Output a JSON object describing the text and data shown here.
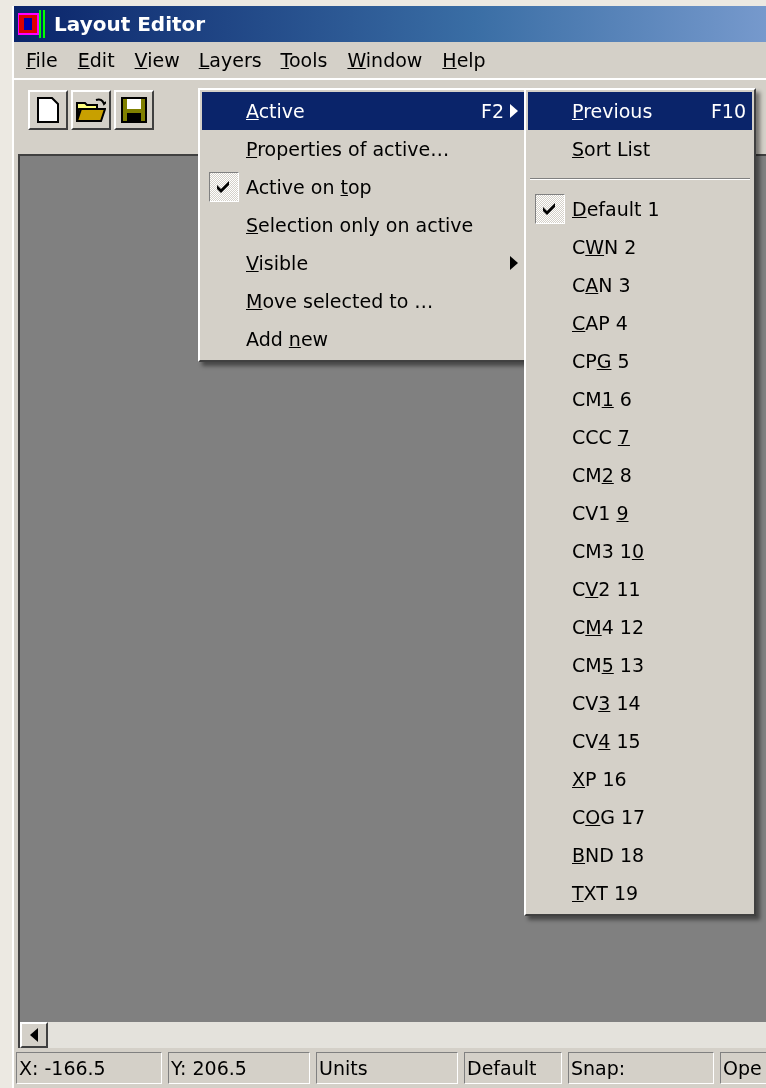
{
  "window": {
    "title": "Layout Editor"
  },
  "menu_bar": [
    {
      "label": {
        "key": "F",
        "post": "ile"
      },
      "selected": false
    },
    {
      "label": {
        "key": "E",
        "post": "dit"
      },
      "selected": false
    },
    {
      "label": {
        "key": "V",
        "post": "iew"
      },
      "selected": false
    },
    {
      "label": {
        "key": "L",
        "post": "ayers"
      },
      "selected": true
    },
    {
      "label": {
        "key": "T",
        "post": "ools"
      },
      "selected": false
    },
    {
      "label": {
        "key": "W",
        "post": "indow"
      },
      "selected": false
    },
    {
      "label": {
        "key": "H",
        "post": "elp"
      },
      "selected": false
    }
  ],
  "toolbar": [
    {
      "kind": "new"
    },
    {
      "kind": "open"
    },
    {
      "kind": "save"
    }
  ],
  "layers_menu": [
    {
      "kind": "item",
      "label": {
        "key": "A",
        "post": "ctive"
      },
      "shortcut": "F2",
      "submenu": true,
      "checked": false,
      "selected": true
    },
    {
      "kind": "item",
      "label": {
        "key": "P",
        "post": "roperties of active…"
      },
      "submenu": false,
      "checked": false,
      "selected": false
    },
    {
      "kind": "item",
      "label": {
        "pre": "Active on ",
        "key": "t",
        "post": "op"
      },
      "submenu": false,
      "checked": true,
      "selected": false
    },
    {
      "kind": "item",
      "label": {
        "key": "S",
        "post": "election only on active"
      },
      "submenu": false,
      "checked": false,
      "selected": false
    },
    {
      "kind": "item",
      "label": {
        "key": "V",
        "post": "isible"
      },
      "submenu": true,
      "checked": false,
      "selected": false
    },
    {
      "kind": "item",
      "label": {
        "key": "M",
        "post": "ove selected to …"
      },
      "submenu": false,
      "checked": false,
      "selected": false
    },
    {
      "kind": "item",
      "label": {
        "pre": "Add ",
        "key": "n",
        "post": "ew"
      },
      "submenu": false,
      "checked": false,
      "selected": false
    }
  ],
  "active_submenu": [
    {
      "kind": "item",
      "label": {
        "key": "P",
        "post": "revious"
      },
      "shortcut": "F10",
      "checked": false,
      "selected": true
    },
    {
      "kind": "item",
      "label": {
        "key": "S",
        "post": "ort List"
      },
      "checked": false,
      "selected": false
    },
    {
      "kind": "separator"
    },
    {
      "kind": "item",
      "label": {
        "key": "D",
        "post": "efault 1"
      },
      "checked": true,
      "selected": false
    },
    {
      "kind": "item",
      "label": {
        "pre": "C",
        "key": "W",
        "post": "N 2"
      },
      "checked": false,
      "selected": false
    },
    {
      "kind": "item",
      "label": {
        "pre": "C",
        "key": "A",
        "post": "N 3"
      },
      "checked": false,
      "selected": false
    },
    {
      "kind": "item",
      "label": {
        "key": "C",
        "post": "AP 4"
      },
      "checked": false,
      "selected": false
    },
    {
      "kind": "item",
      "label": {
        "pre": "CP",
        "key": "G",
        "post": " 5"
      },
      "checked": false,
      "selected": false
    },
    {
      "kind": "item",
      "label": {
        "pre": "CM",
        "key": "1",
        "post": " 6"
      },
      "checked": false,
      "selected": false
    },
    {
      "kind": "item",
      "label": {
        "pre": "CCC ",
        "key": "7"
      },
      "checked": false,
      "selected": false
    },
    {
      "kind": "item",
      "label": {
        "pre": "CM",
        "key": "2",
        "post": " 8"
      },
      "checked": false,
      "selected": false
    },
    {
      "kind": "item",
      "label": {
        "pre": "CV1 ",
        "key": "9"
      },
      "checked": false,
      "selected": false
    },
    {
      "kind": "item",
      "label": {
        "pre": "CM3 1",
        "key": "0"
      },
      "checked": false,
      "selected": false
    },
    {
      "kind": "item",
      "label": {
        "pre": "C",
        "key": "V",
        "post": "2 11"
      },
      "checked": false,
      "selected": false
    },
    {
      "kind": "item",
      "label": {
        "pre": "C",
        "key": "M",
        "post": "4 12"
      },
      "checked": false,
      "selected": false
    },
    {
      "kind": "item",
      "label": {
        "pre": "CM",
        "key": "5",
        "post": " 13"
      },
      "checked": false,
      "selected": false
    },
    {
      "kind": "item",
      "label": {
        "pre": "CV",
        "key": "3",
        "post": " 14"
      },
      "checked": false,
      "selected": false
    },
    {
      "kind": "item",
      "label": {
        "pre": "CV",
        "key": "4",
        "post": " 15"
      },
      "checked": false,
      "selected": false
    },
    {
      "kind": "item",
      "label": {
        "key": "X",
        "post": "P 16"
      },
      "checked": false,
      "selected": false
    },
    {
      "kind": "item",
      "label": {
        "pre": "C",
        "key": "O",
        "post": "G 17"
      },
      "checked": false,
      "selected": false
    },
    {
      "kind": "item",
      "label": {
        "key": "B",
        "post": "ND 18"
      },
      "checked": false,
      "selected": false
    },
    {
      "kind": "item",
      "label": {
        "key": "T",
        "post": "XT 19"
      },
      "checked": false,
      "selected": false
    }
  ],
  "status_bar": [
    "X: -166.5",
    "Y: 206.5",
    "Units",
    "Default",
    "Snap:",
    "Ope"
  ]
}
